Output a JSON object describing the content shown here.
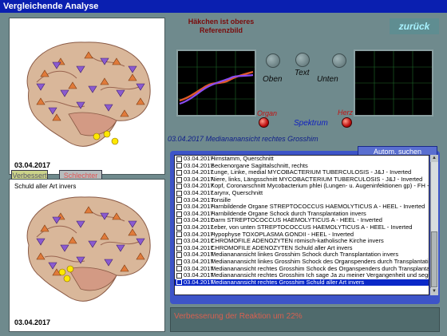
{
  "window": {
    "title": "Vergleichende Analyse"
  },
  "header": {
    "hint": "Häkchen ist oberes Referenzbild",
    "back_label": "zurück"
  },
  "panels": {
    "top": {
      "date": "03.04.2017"
    },
    "bottom": {
      "date": "03.04.2017",
      "note": "Schuld aller Art invers"
    }
  },
  "tabs": {
    "better": "Verbessert",
    "worse": "Schlechter"
  },
  "controls": {
    "oben": "Oben",
    "text": "Text",
    "unten": "Unten",
    "organ": "Organ",
    "herz": "Herz",
    "spektrum": "Spektrum"
  },
  "analysis_caption": "03.04.2017 Mediananansicht rechtes Grosshim",
  "auto_search": "Autom. suchen",
  "list": {
    "rows": [
      {
        "date": "03.04.2017",
        "text": "Hirnstamm, Querschnitt",
        "selected": false
      },
      {
        "date": "03.04.2017",
        "text": "Beckenorgane Sagittalschnitt, rechts",
        "selected": false
      },
      {
        "date": "03.04.2017",
        "text": "Lunge, Linke, medial  MYCOBACTERIUM  TUBERCULOSIS  -  J&J - Inverted",
        "selected": false
      },
      {
        "date": "03.04.2017",
        "text": "Niere, links, Längsschnitt  MYCOBACTERIUM  TUBERCULOSIS  -  J&J - Inverted",
        "selected": false
      },
      {
        "date": "03.04.2017",
        "text": "Kopf, Coronarschnitt  Mycobacterium phlei (Lungen- u. Augeninfektionen gp) - FH - Inverted",
        "selected": false
      },
      {
        "date": "03.04.2017",
        "text": "Larynx, Querschnitt",
        "selected": false
      },
      {
        "date": "03.04.2017",
        "text": "Tonsille",
        "selected": false
      },
      {
        "date": "03.04.2017",
        "text": "Harnbildende Organe  STREPTOCOCCUS  HAEMOLYTICUS  A   -  HEEL - Inverted",
        "selected": false
      },
      {
        "date": "03.04.2017",
        "text": "Harnbildende Organe  Schock durch Transplantation invers",
        "selected": false
      },
      {
        "date": "03.04.2017",
        "text": "Darm  STREPTOCOCCUS  HAEMOLYTICUS  A   -  HEEL - Inverted",
        "selected": false
      },
      {
        "date": "03.04.2017",
        "text": "Leber, von unten  STREPTOCOCCUS  HAEMOLYTICUS  A   -  HEEL - Inverted",
        "selected": false
      },
      {
        "date": "03.04.2017",
        "text": "Hypophyse  TOXOPLASMA  GONDII  -  HEEL - Inverted",
        "selected": false
      },
      {
        "date": "03.04.2017",
        "text": "CHROMOFILE ADENOZYTEN  römisch-katholische Kirche invers",
        "selected": false
      },
      {
        "date": "03.04.2017",
        "text": "CHROMOFILE ADENOZYTEN  Schuld aller Art invers",
        "selected": false
      },
      {
        "date": "03.04.2017",
        "text": "Mediananansicht linkes Grosshim  Schock durch Transplantation invers",
        "selected": false
      },
      {
        "date": "03.04.2017",
        "text": "Mediananansicht linkes Grosshim  Schock des Organspenders durch Transplantation invers",
        "selected": false
      },
      {
        "date": "03.04.2017",
        "text": "Mediananansicht rechtes Grosshim  Schock des Organspenders durch Transplantation invers",
        "selected": false
      },
      {
        "date": "03.04.2017",
        "text": "Mediananansicht rechtes Grosshim  Ich sage Ja zu meiner Vergangenheit und segne sie",
        "selected": false
      },
      {
        "date": "03.04.2017",
        "text": "Mediananansicht rechtes Grosshim  Schuld aller Art invers",
        "selected": true
      }
    ]
  },
  "result": {
    "text": "Verbesserung der Reaktion um 22%"
  },
  "colors": {
    "titlebar": "#0a1fb0",
    "background": "#6f8a8d",
    "selection": "#0a28c8",
    "curve_red": "#e05a28",
    "curve_purple": "#8a4cf0"
  },
  "icons": {
    "marker_up": "orange-triangle-up",
    "marker_down": "purple-triangle-down",
    "marker_active": "yellow-hexagon"
  }
}
